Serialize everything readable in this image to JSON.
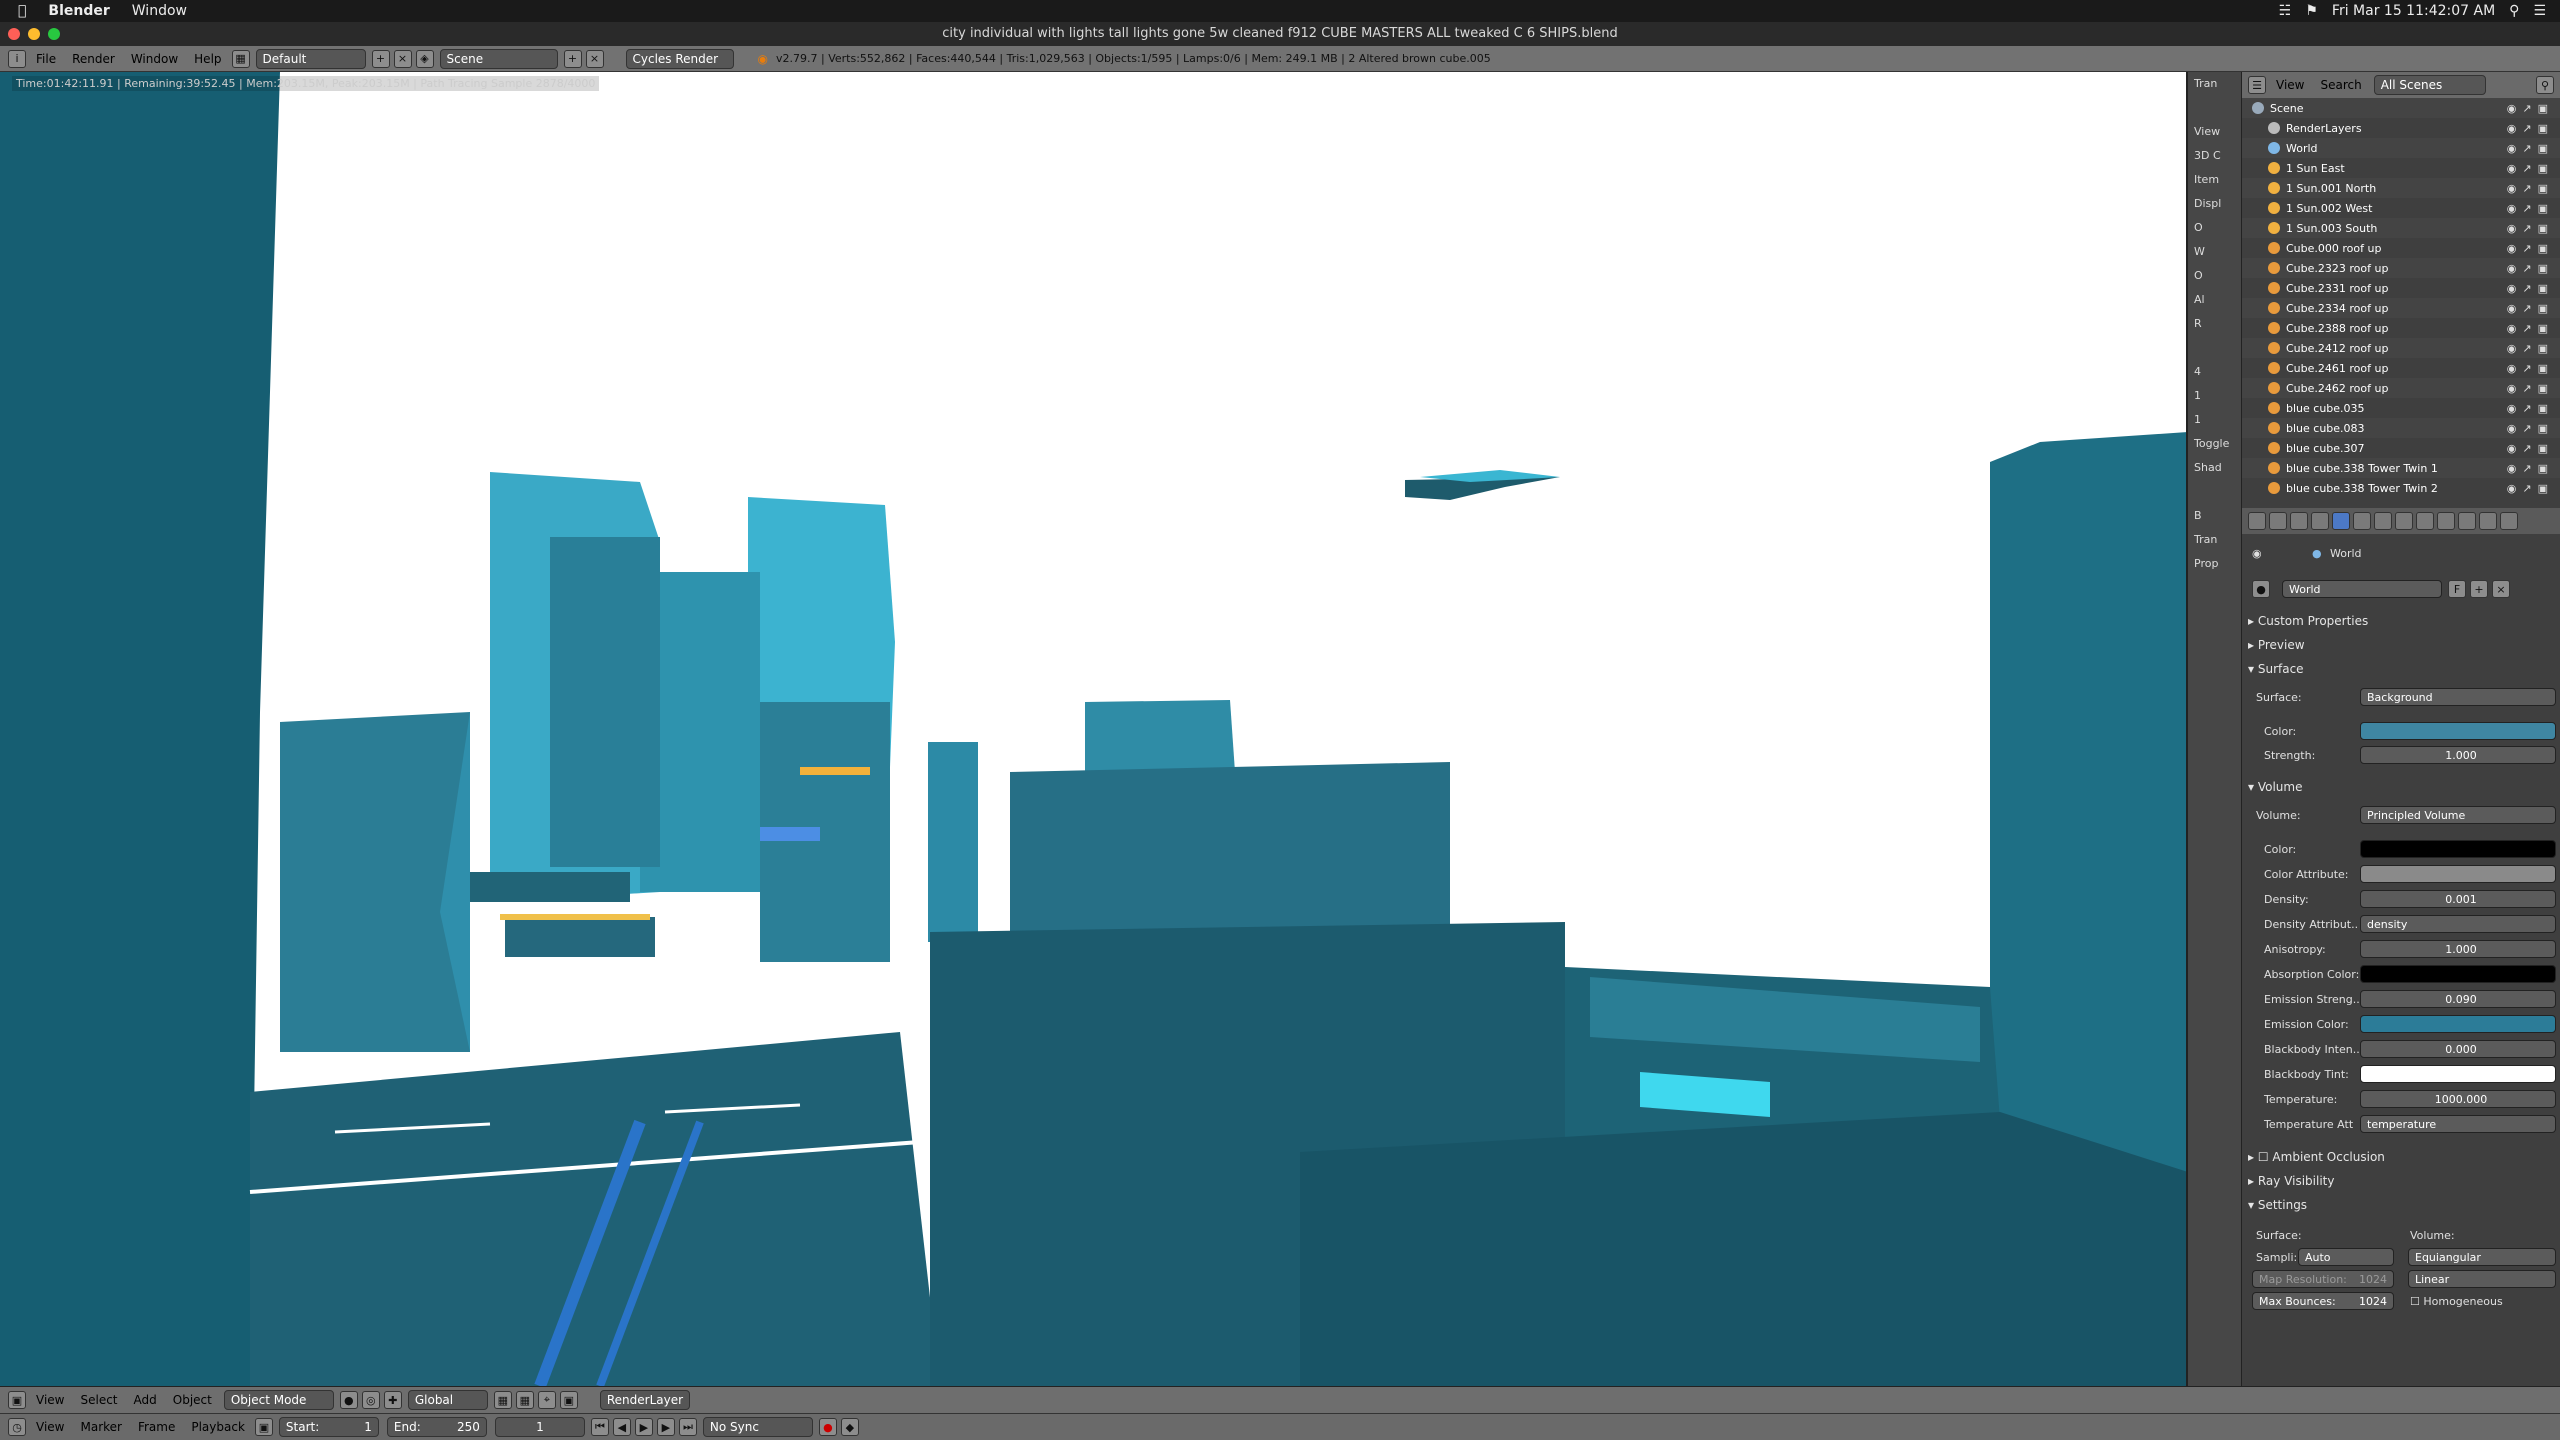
{
  "mac_menubar": {
    "app": "Blender",
    "window": "Window",
    "datetime": "Fri Mar 15  11:42:07 AM"
  },
  "window_title": "city individual with lights tall lights gone 5w cleaned f912 CUBE MASTERS  ALL tweaked  C  6 SHIPS.blend",
  "info_header": {
    "menus": [
      "File",
      "Render",
      "Window",
      "Help"
    ],
    "layout": "Default",
    "scene": "Scene",
    "engine": "Cycles Render",
    "stats": "v2.79.7 | Verts:552,862 | Faces:440,544 | Tris:1,029,563 | Objects:1/595 | Lamps:0/6 | Mem: 249.1 MB | 2 Altered brown cube.005"
  },
  "render_stats": "Time:01:42:11.91 | Remaining:39:52.45 | Mem:203.15M, Peak:203.15M | Path Tracing Sample 2878/4000",
  "tools_strip": [
    "Tran",
    "",
    "View",
    "3D C",
    "Item",
    "Displ",
    "O",
    "W",
    "O",
    "Al",
    "R",
    "",
    "4",
    "1",
    "1",
    "Toggle",
    "Shad",
    "",
    "B",
    "Tran",
    "Prop"
  ],
  "outliner": {
    "menus": [
      "View",
      "Search"
    ],
    "filter": "All Scenes",
    "items": [
      {
        "label": "Scene",
        "type": "scene"
      },
      {
        "label": "RenderLayers",
        "type": "layer"
      },
      {
        "label": "World",
        "type": "world"
      },
      {
        "label": "1 Sun East",
        "type": "lamp"
      },
      {
        "label": "1 Sun.001 North",
        "type": "lamp"
      },
      {
        "label": "1 Sun.002 West",
        "type": "lamp"
      },
      {
        "label": "1 Sun.003 South",
        "type": "lamp"
      },
      {
        "label": "Cube.000 roof up",
        "type": "mesh"
      },
      {
        "label": "Cube.2323 roof up",
        "type": "mesh"
      },
      {
        "label": "Cube.2331 roof up",
        "type": "mesh"
      },
      {
        "label": "Cube.2334 roof up",
        "type": "mesh"
      },
      {
        "label": "Cube.2388 roof up",
        "type": "mesh"
      },
      {
        "label": "Cube.2412 roof up",
        "type": "mesh"
      },
      {
        "label": "Cube.2461 roof up",
        "type": "mesh"
      },
      {
        "label": "Cube.2462 roof up",
        "type": "mesh"
      },
      {
        "label": "blue cube.035",
        "type": "mesh"
      },
      {
        "label": "blue cube.083",
        "type": "mesh"
      },
      {
        "label": "blue cube.307",
        "type": "mesh"
      },
      {
        "label": "blue cube.338 Tower Twin 1",
        "type": "mesh"
      },
      {
        "label": "blue cube.338 Tower Twin 2",
        "type": "mesh"
      }
    ]
  },
  "props": {
    "breadcrumb": "World",
    "world_name": "World",
    "world_flag": "F",
    "sections": {
      "custom": "Custom Properties",
      "preview": "Preview",
      "surface": "Surface",
      "volume": "Volume",
      "ao": "Ambient Occlusion",
      "ray": "Ray Visibility",
      "settings": "Settings"
    },
    "surface": {
      "label": "Surface:",
      "value": "Background",
      "color_label": "Color:",
      "color": "#3f86a2",
      "strength_label": "Strength:",
      "strength": "1.000"
    },
    "volume": {
      "label": "Volume:",
      "value": "Principled Volume",
      "fields": [
        {
          "label": "Color:",
          "value": "",
          "swatch": "#000000"
        },
        {
          "label": "Color Attribute:",
          "value": "",
          "swatch": "#8a8a8a"
        },
        {
          "label": "Density:",
          "value": "0.001"
        },
        {
          "label": "Density Attribut..",
          "value": "density"
        },
        {
          "label": "Anisotropy:",
          "value": "1.000"
        },
        {
          "label": "Absorption Color:",
          "value": "",
          "swatch": "#000000"
        },
        {
          "label": "Emission Streng..",
          "value": "0.090"
        },
        {
          "label": "Emission Color:",
          "value": "",
          "swatch": "#2c7c98"
        },
        {
          "label": "Blackbody Inten..",
          "value": "0.000"
        },
        {
          "label": "Blackbody Tint:",
          "value": "",
          "swatch": "#ffffff"
        },
        {
          "label": "Temperature:",
          "value": "1000.000"
        },
        {
          "label": "Temperature Att",
          "value": "temperature"
        }
      ]
    },
    "settings": {
      "surface_label": "Surface:",
      "volume_label": "Volume:",
      "sampling_label": "Sampli:",
      "sampling_value": "Auto",
      "volume_sampling": "Equiangular",
      "map_res_label": "Map Resolution:",
      "map_res_value": "1024",
      "interp": "Linear",
      "max_bounces_label": "Max Bounces:",
      "max_bounces_value": "1024",
      "homogeneous": "Homogeneous"
    }
  },
  "tl_header": {
    "menus": [
      "View",
      "Select",
      "Add",
      "Object"
    ],
    "mode": "Object Mode",
    "orientation": "Global",
    "layer": "RenderLayer"
  },
  "tl_footer": {
    "menus": [
      "View",
      "Marker",
      "Frame",
      "Playback"
    ],
    "start_label": "Start:",
    "start": "1",
    "end_label": "End:",
    "end": "250",
    "current": "1",
    "sync": "No Sync"
  }
}
